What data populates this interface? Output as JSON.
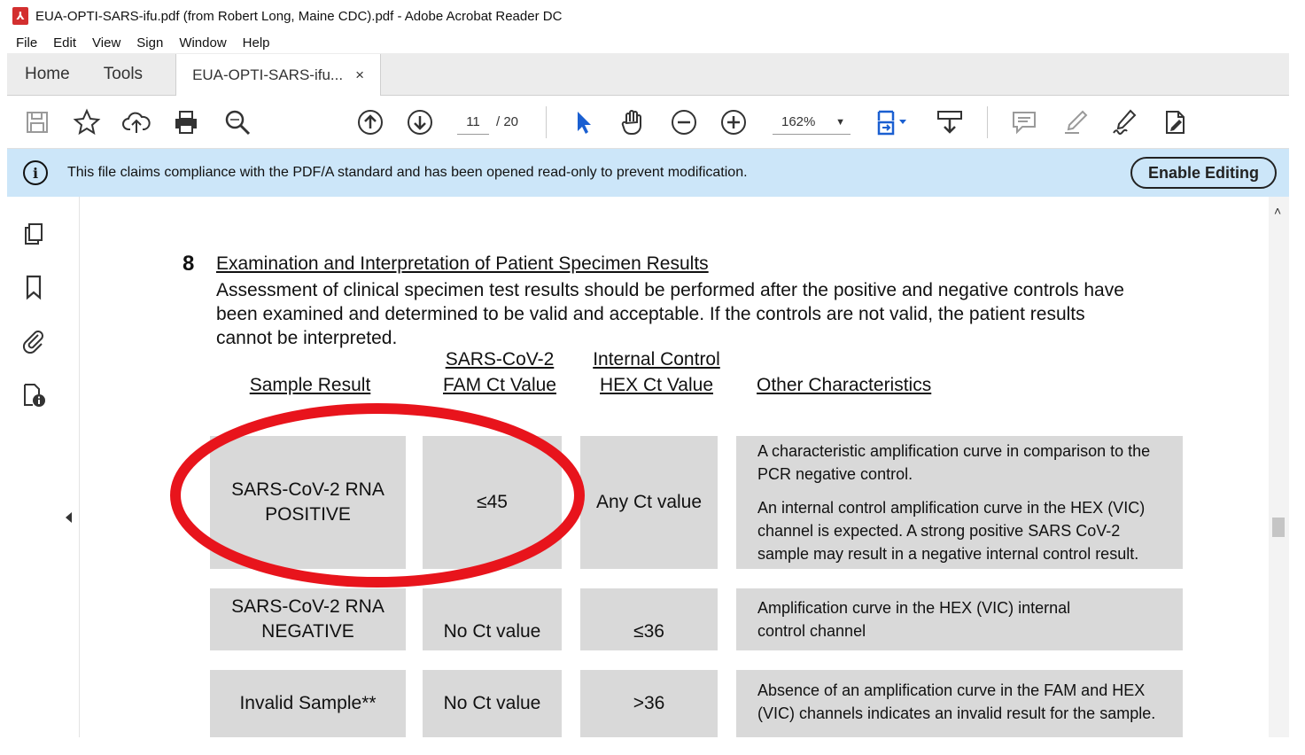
{
  "window": {
    "title": "EUA-OPTI-SARS-ifu.pdf (from Robert Long, Maine CDC).pdf - Adobe Acrobat Reader DC"
  },
  "menu": [
    "File",
    "Edit",
    "View",
    "Sign",
    "Window",
    "Help"
  ],
  "tabs": {
    "home": "Home",
    "tools": "Tools",
    "document": "EUA-OPTI-SARS-ifu...",
    "close": "×"
  },
  "toolbar": {
    "page_current": "11",
    "page_total": "/ 20",
    "zoom": "162%"
  },
  "infobar": {
    "message": "This file claims compliance with the PDF/A standard and has been opened read-only to prevent modification.",
    "button": "Enable Editing"
  },
  "document": {
    "section_number": "8",
    "section_title": "Examination and Interpretation of Patient Specimen Results",
    "paragraph": "Assessment of clinical specimen test results should be performed after the positive and negative controls have been examined and determined to be valid and acceptable. If the controls are not valid, the patient results cannot be interpreted.",
    "headers": {
      "sample_result": "Sample Result",
      "fam_line1": "SARS-CoV-2",
      "fam_line2": "FAM Ct Value",
      "hex_line1": "Internal Control",
      "hex_line2": "HEX Ct Value",
      "other": "Other Characteristics"
    },
    "rows": [
      {
        "sample_line1": "SARS-CoV-2 RNA",
        "sample_line2": "POSITIVE",
        "fam": "≤45",
        "hex": "Any Ct value",
        "desc1": "A characteristic amplification curve in comparison to the PCR negative control.",
        "desc2": "An internal control amplification curve in the HEX (VIC) channel is expected. A strong positive SARS CoV-2 sample may result in a negative internal control result."
      },
      {
        "sample_line1": "SARS-CoV-2 RNA",
        "sample_line2": "NEGATIVE",
        "fam": "No Ct value",
        "hex": "≤36",
        "desc1": "Amplification curve in the HEX (VIC) internal control channel"
      },
      {
        "sample_line1": "Invalid Sample**",
        "fam": "No Ct value",
        "hex": ">36",
        "desc1": "Absence of an amplification curve in the FAM and HEX (VIC) channels indicates an invalid result for the sample."
      }
    ]
  },
  "colors": {
    "infobar_bg": "#cce6f9",
    "cell_bg": "#d9d9d9",
    "annotation_red": "#e8141c",
    "pointer_blue": "#1a5fd1",
    "pdf_red": "#d32f2f"
  }
}
